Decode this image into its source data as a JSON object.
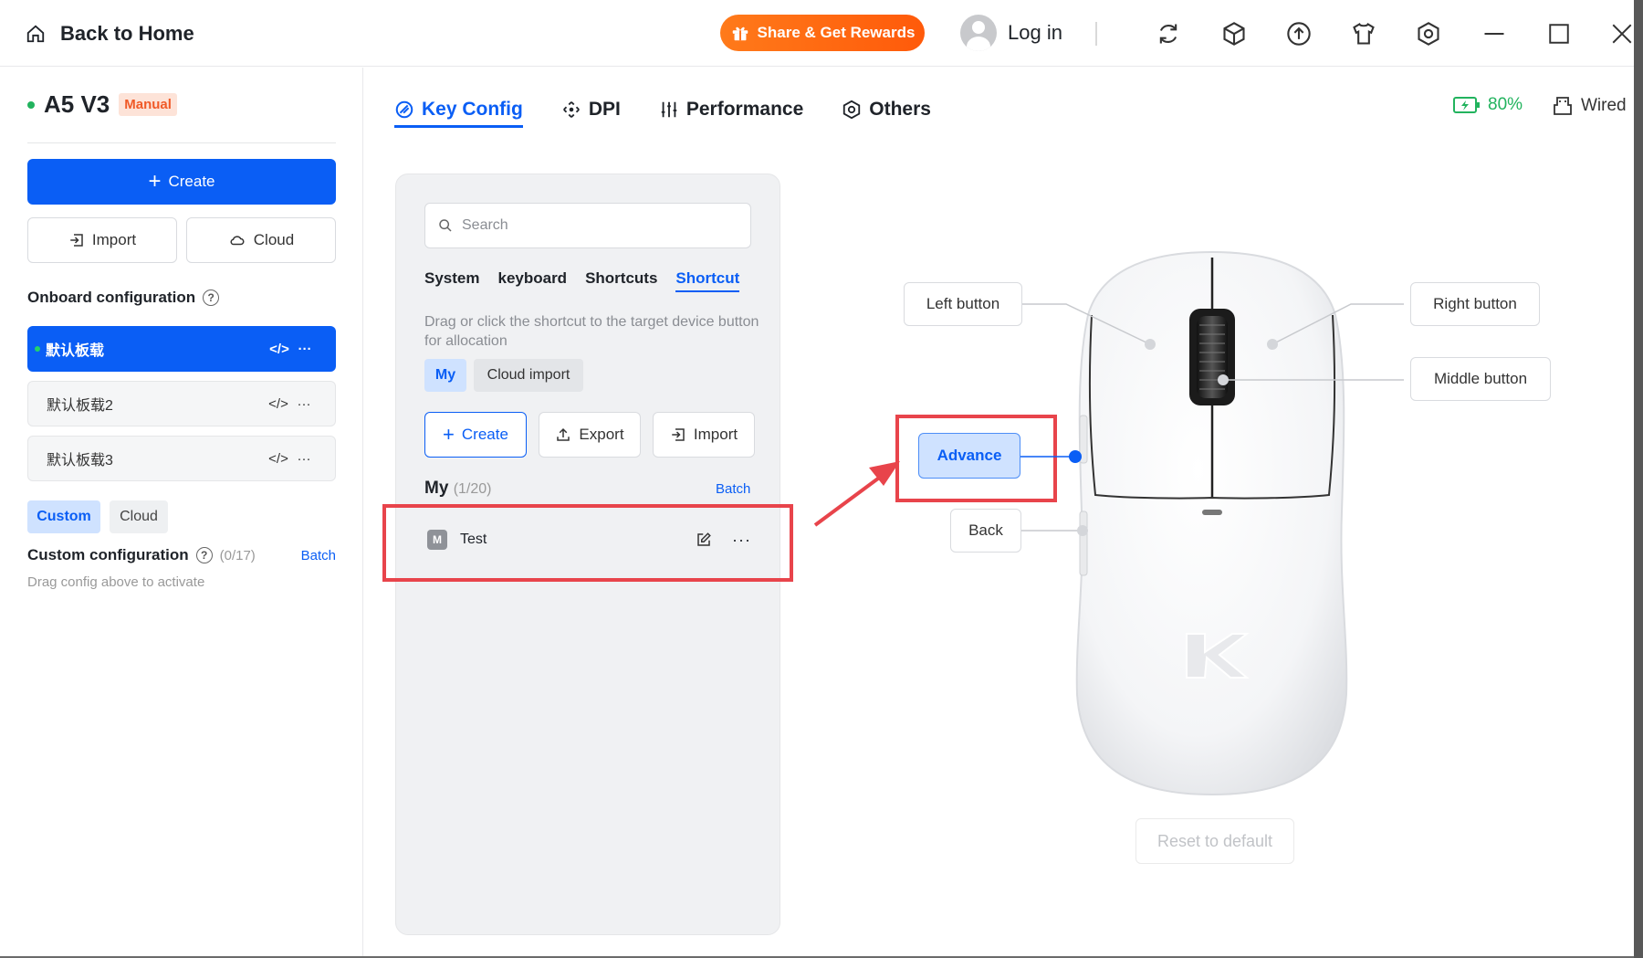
{
  "titlebar": {
    "back_label": "Back to Home",
    "share_label": "Share & Get Rewards",
    "login_label": "Log in",
    "icons": [
      "refresh-icon",
      "cube-icon",
      "upload-icon",
      "tshirt-icon",
      "settings-hex-icon",
      "minimize-icon",
      "maximize-icon",
      "close-icon"
    ]
  },
  "sidebar": {
    "device_name": "A5 V3",
    "mode_badge": "Manual",
    "create_label": "Create",
    "import_label": "Import",
    "cloud_label": "Cloud",
    "onboard_title": "Onboard configuration",
    "onboard_items": [
      {
        "label": "默认板载",
        "active": true
      },
      {
        "label": "默认板载2",
        "active": false
      },
      {
        "label": "默认板载3",
        "active": false
      }
    ],
    "tag_custom": "Custom",
    "tag_cloud": "Cloud",
    "custom_title": "Custom configuration",
    "custom_count": "(0/17)",
    "custom_batch": "Batch",
    "custom_hint": "Drag config above to activate"
  },
  "main": {
    "tabs": [
      {
        "label": "Key Config",
        "icon": "key-config-icon",
        "active": true
      },
      {
        "label": "DPI",
        "icon": "dpi-move-icon",
        "active": false
      },
      {
        "label": "Performance",
        "icon": "sliders-icon",
        "active": false
      },
      {
        "label": "Others",
        "icon": "hex-gear-icon",
        "active": false
      }
    ],
    "battery": "80%",
    "connection": "Wired"
  },
  "panel": {
    "search_placeholder": "Search",
    "subtabs": [
      {
        "label": "System",
        "active": false
      },
      {
        "label": "keyboard",
        "active": false
      },
      {
        "label": "Shortcuts",
        "active": false
      },
      {
        "label": "Shortcut",
        "active": true
      }
    ],
    "hint": "Drag or click the shortcut to the target device button for allocation",
    "pill_my": "My",
    "pill_cloud": "Cloud import",
    "create_label": "Create",
    "export_label": "Export",
    "import_label": "Import",
    "my_title": "My",
    "my_count": "(1/20)",
    "batch_label": "Batch",
    "items": [
      {
        "badge": "M",
        "name": "Test"
      }
    ]
  },
  "mouse": {
    "left_button": "Left button",
    "right_button": "Right button",
    "middle_button": "Middle button",
    "advance_button": "Advance",
    "back_button": "Back",
    "reset_label": "Reset to default"
  },
  "colors": {
    "accent": "#0a5ef5",
    "battery": "#22b35e",
    "highlight": "#e8444b",
    "share": "#ff6a10"
  }
}
